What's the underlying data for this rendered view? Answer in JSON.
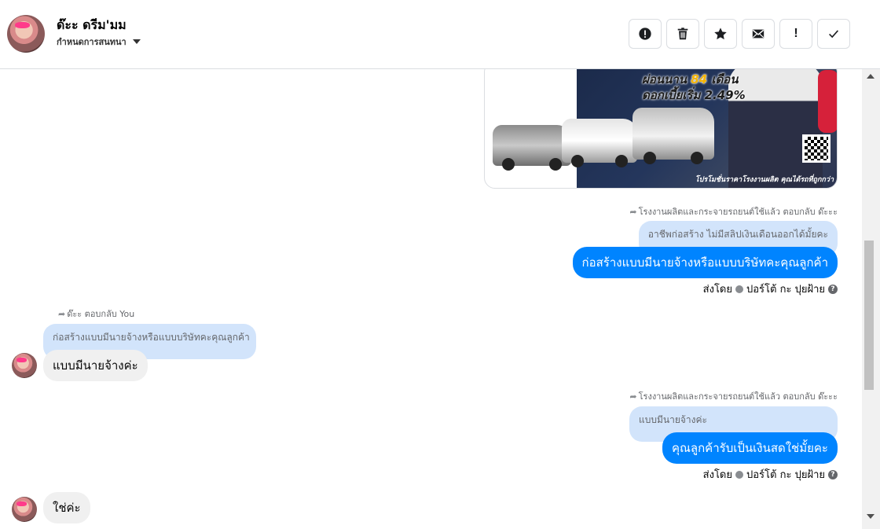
{
  "header": {
    "contact_name": "ด๊ะะ ดรีม'มม",
    "conversation_settings": "กำหนดการสนทนา"
  },
  "toolbar": {
    "buttons": [
      "alert-circle-icon",
      "trash-icon",
      "star-icon",
      "mail-icon",
      "exclamation-icon",
      "check-icon"
    ],
    "exclamation_label": "!"
  },
  "ad": {
    "headline_line1": "ผ่อนนาน 84 เดือน",
    "headline_highlight1": "84",
    "headline_line2": "ดอกเบี้ยเริ่ม 2.49%",
    "footer": "โปรโมชั่นราคาโรงงานผลิต คุณได้รถที่ถูกกว่า"
  },
  "messages": {
    "m1": {
      "reply_meta": "โรงงานผลิตและกระจายรถยนต์ใช้แล้ว ตอบกลับ ด๊ะะะ",
      "quote": "อาชีพก่อสร้าง ไม่มีสลิปเงินเดือนออกได้มั้ยคะ",
      "text": "ก่อสร้างแบบมีนายจ้างหรือแบบบริษัทคะคุณลูกค้า",
      "sent_by_prefix": "ส่งโดย",
      "sent_by_name": "ปอร์โต้ กะ ปุยฝ้าย"
    },
    "m2": {
      "reply_meta": "ด๊ะะ ตอบกลับ You",
      "quote": "ก่อสร้างแบบมีนายจ้างหรือแบบบริษัทคะคุณลูกค้า",
      "text": "แบบมีนายจ้างค่ะ"
    },
    "m3": {
      "reply_meta": "โรงงานผลิตและกระจายรถยนต์ใช้แล้ว ตอบกลับ ด๊ะะะ",
      "quote": "แบบมีนายจ้างค่ะ",
      "text": "คุณลูกค้ารับเป็นเงินสดใช่มั้ยคะ",
      "sent_by_prefix": "ส่งโดย",
      "sent_by_name": "ปอร์โต้ กะ ปุยฝ้าย"
    },
    "m4": {
      "text": "ใช่ค่ะ"
    }
  }
}
